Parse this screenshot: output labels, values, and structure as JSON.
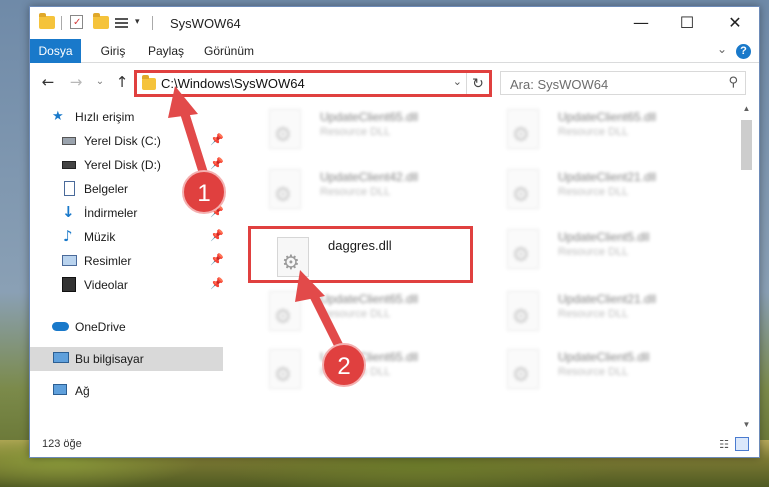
{
  "window": {
    "title": "SysWOW64",
    "minimize": "—",
    "maximize": "☐",
    "close": "✕"
  },
  "ribbon": {
    "tabs": [
      "Dosya",
      "Giriş",
      "Paylaş",
      "Görünüm"
    ],
    "help": "?",
    "expand": "⌄"
  },
  "navigation": {
    "back": "←",
    "forward": "→",
    "recent": "⌄",
    "up": "↑",
    "address": "C:\\Windows\\SysWOW64",
    "address_dropdown": "⌄",
    "refresh": "↻",
    "search_placeholder": "Ara: SysWOW64",
    "search_icon": "⚲"
  },
  "nav_pane": {
    "quick_access": "Hızlı erişim",
    "items": [
      {
        "label": "Yerel Disk (C:)",
        "icon": "drive-icon",
        "pinned": true
      },
      {
        "label": "Yerel Disk (D:)",
        "icon": "drive-icon",
        "pinned": true
      },
      {
        "label": "Belgeler",
        "icon": "document-icon",
        "pinned": true
      },
      {
        "label": "İndirmeler",
        "icon": "download-icon",
        "pinned": true
      },
      {
        "label": "Müzik",
        "icon": "music-icon",
        "pinned": true
      },
      {
        "label": "Resimler",
        "icon": "pictures-icon",
        "pinned": true
      },
      {
        "label": "Videolar",
        "icon": "video-icon",
        "pinned": true
      }
    ],
    "onedrive": "OneDrive",
    "this_pc": "Bu bilgisayar",
    "network": "Ağ",
    "pin_glyph": "📌"
  },
  "files": [
    {
      "name": "UpdateClient65.dll",
      "type": "Resource DLL",
      "blurred": true
    },
    {
      "name": "UpdateClient65.dll",
      "type": "Resource DLL",
      "blurred": true
    },
    {
      "name": "UpdateClient42.dll",
      "type": "Resource DLL",
      "blurred": true
    },
    {
      "name": "UpdateClient21.dll",
      "type": "Resource DLL",
      "blurred": true
    },
    {
      "name": "daggres.dll",
      "type": "",
      "blurred": false
    },
    {
      "name": "UpdateClient5.dll",
      "type": "Resource DLL",
      "blurred": true
    },
    {
      "name": "UpdateClient65.dll",
      "type": "Resource DLL",
      "blurred": true
    },
    {
      "name": "UpdateClient21.dll",
      "type": "Resource DLL",
      "blurred": true
    },
    {
      "name": "UpdateClient65.dll",
      "type": "Resource DLL",
      "blurred": true
    },
    {
      "name": "UpdateClient5.dll",
      "type": "Resource DLL",
      "blurred": true
    }
  ],
  "status": {
    "count": "123 öğe"
  },
  "callouts": {
    "one": "1",
    "two": "2"
  },
  "colors": {
    "accent": "#1979ca",
    "highlight": "#e0403f"
  }
}
